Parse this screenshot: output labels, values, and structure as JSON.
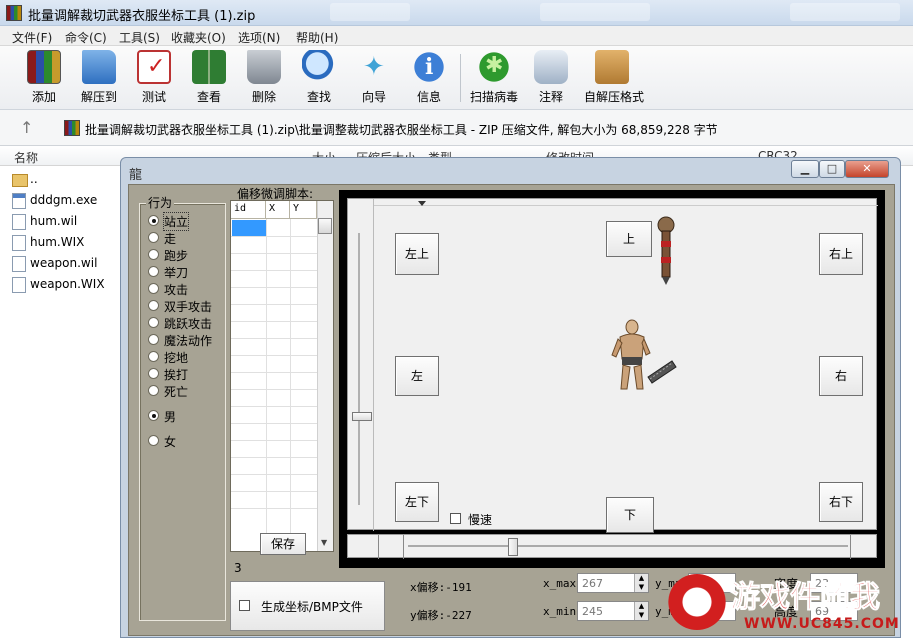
{
  "window": {
    "title": "批量调解裁切武器衣服坐标工具 (1).zip"
  },
  "menu": [
    "文件(F)",
    "命令(C)",
    "工具(S)",
    "收藏夹(O)",
    "选项(N)",
    "帮助(H)"
  ],
  "toolbar": [
    {
      "label": "添加",
      "icon": "add-archive-icon"
    },
    {
      "label": "解压到",
      "icon": "extract-folder-icon"
    },
    {
      "label": "测试",
      "icon": "test-clipboard-icon"
    },
    {
      "label": "查看",
      "icon": "view-book-icon"
    },
    {
      "label": "删除",
      "icon": "delete-trash-icon"
    },
    {
      "label": "查找",
      "icon": "find-magnifier-icon"
    },
    {
      "label": "向导",
      "icon": "wizard-wand-icon"
    },
    {
      "label": "信息",
      "icon": "info-icon"
    },
    {
      "label": "扫描病毒",
      "icon": "virus-scan-icon"
    },
    {
      "label": "注释",
      "icon": "comment-icon"
    },
    {
      "label": "自解压格式",
      "icon": "sfx-box-icon"
    }
  ],
  "address": {
    "path": "批量调解裁切武器衣服坐标工具 (1).zip\\批量调整裁切武器衣服坐标工具 - ZIP 压缩文件, 解包大小为 68,859,228 字节"
  },
  "columns": [
    "名称",
    "大小",
    "压缩后大小",
    "类型",
    "修改时间",
    "CRC32"
  ],
  "files": [
    {
      "name": "..",
      "kind": "folder"
    },
    {
      "name": "dddgm.exe",
      "kind": "exe"
    },
    {
      "name": "hum.wil",
      "kind": "file"
    },
    {
      "name": "hum.WIX",
      "kind": "file"
    },
    {
      "name": "weapon.wil",
      "kind": "file"
    },
    {
      "name": "weapon.WIX",
      "kind": "file"
    }
  ],
  "dialog": {
    "icon_text": "龍",
    "window_buttons": {
      "minimize": "▁",
      "maximize": "□",
      "close": "✕"
    },
    "action_group": {
      "title": "行为",
      "options": [
        "站立",
        "走",
        "跑步",
        "举刀",
        "攻击",
        "双手攻击",
        "跳跃攻击",
        "魔法动作",
        "挖地",
        "挨打",
        "死亡"
      ],
      "selected": "站立"
    },
    "gender": {
      "options": [
        "男",
        "女"
      ],
      "selected": "男"
    },
    "script": {
      "label": "偏移微调脚本:",
      "columns": [
        "id",
        "X",
        "Y"
      ],
      "save_label": "保存",
      "count": "3"
    },
    "direction_buttons": {
      "up_left": "左上",
      "up": "上",
      "up_right": "右上",
      "left": "左",
      "right": "右",
      "down_left": "左下",
      "down": "下",
      "down_right": "右下"
    },
    "slow_label": "慢速",
    "slow_checked": false,
    "generate_label": "生成坐标/BMP文件",
    "generate_checked": false,
    "x_offset_text": "x偏移:-191",
    "y_offset_text": "y偏移:-227",
    "x_max": {
      "label": "x_max",
      "value": "267"
    },
    "x_min": {
      "label": "x_min",
      "value": "245"
    },
    "y_max": {
      "label": "y_max",
      "value": "1?"
    },
    "y_min": {
      "label": "y_m",
      "value": ""
    },
    "width": {
      "label": "宽度",
      "value": "23"
    },
    "height": {
      "label": "高度",
      "value": "69"
    }
  },
  "watermark": {
    "title": "游戏件随我",
    "url": "WWW.UC845.COM"
  }
}
